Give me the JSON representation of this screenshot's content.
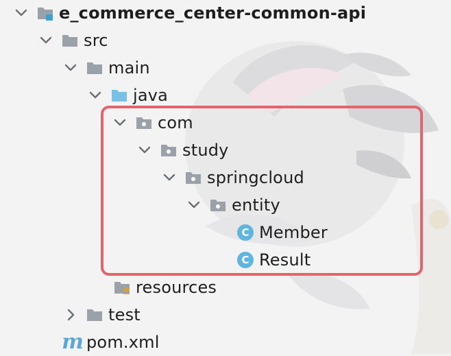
{
  "project_tree": {
    "root": {
      "label": "e_commerce_center-common-api",
      "icon": "module-folder-icon",
      "expanded": true
    },
    "items": [
      {
        "label": "src",
        "icon": "folder-icon",
        "expanded": true
      },
      {
        "label": "main",
        "icon": "folder-icon",
        "expanded": true
      },
      {
        "label": "java",
        "icon": "source-root-folder-icon",
        "expanded": true
      },
      {
        "label": "com",
        "icon": "package-icon",
        "expanded": true
      },
      {
        "label": "study",
        "icon": "package-icon",
        "expanded": true
      },
      {
        "label": "springcloud",
        "icon": "package-icon",
        "expanded": true
      },
      {
        "label": "entity",
        "icon": "package-icon",
        "expanded": true
      },
      {
        "label": "Member",
        "icon": "class-icon",
        "icon_letter": "C"
      },
      {
        "label": "Result",
        "icon": "class-icon",
        "icon_letter": "C"
      },
      {
        "label": "resources",
        "icon": "resources-folder-icon"
      },
      {
        "label": "test",
        "icon": "folder-icon",
        "expanded": false
      },
      {
        "label": "pom.xml",
        "icon": "maven-icon",
        "icon_letter": "m"
      }
    ]
  },
  "colors": {
    "folder": "#9aa1a8",
    "source_root": "#79c0e6",
    "class_icon": "#5fb5dd",
    "highlight_border": "#e5636c"
  }
}
